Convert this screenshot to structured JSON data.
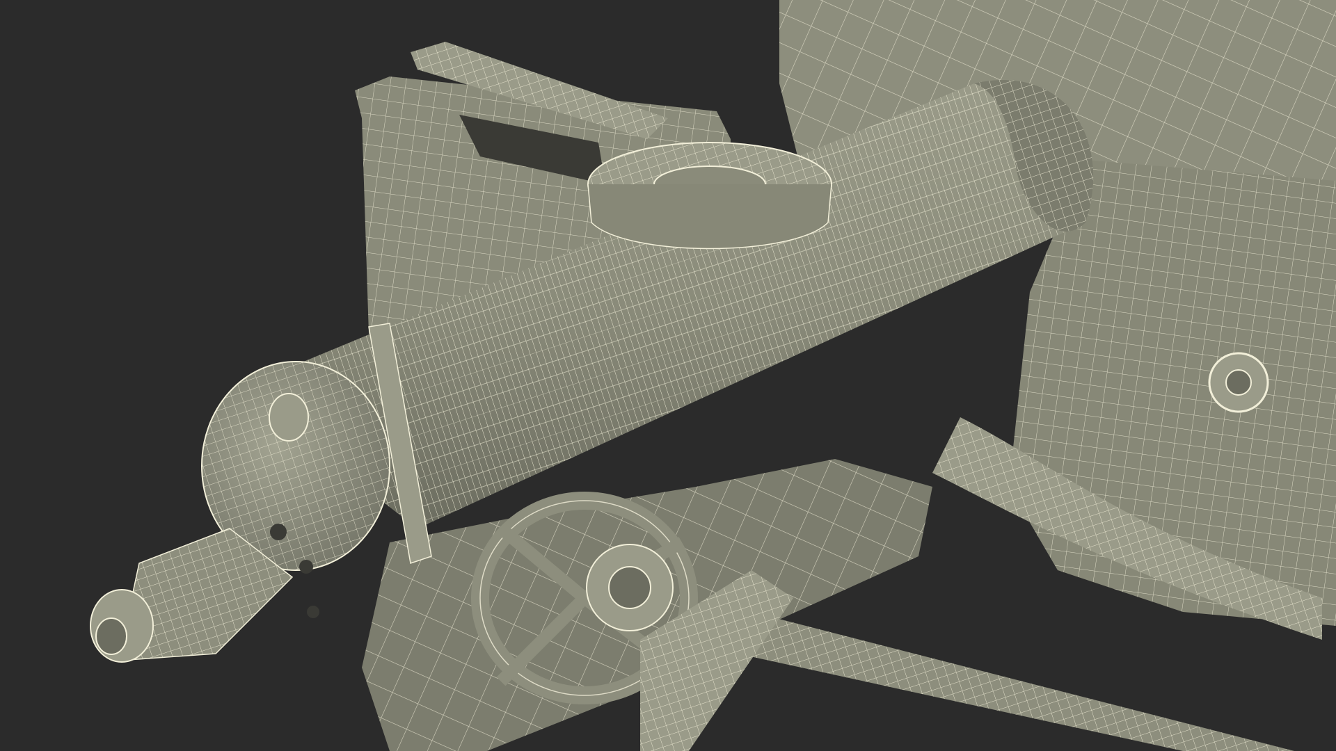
{
  "scene": {
    "background_color": "#2b2b2b",
    "surface_color": "#8d8e7d",
    "surface_shadow_color": "#6f7063",
    "wire_color": "#f2efd9",
    "description_visible_text": ""
  }
}
